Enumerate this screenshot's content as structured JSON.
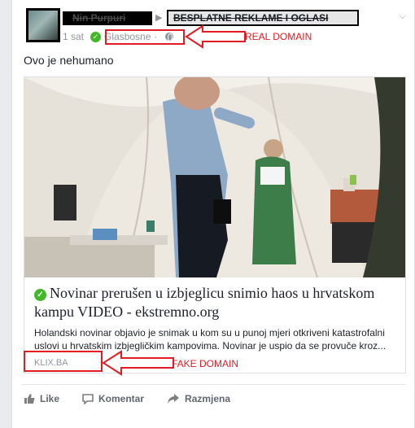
{
  "post": {
    "author": "Nin Purpuri",
    "group": "BESPLATNE REKLAME I OGLASI",
    "time": "1 sat",
    "privacy_label": "Glasbosne",
    "text": "Ovo je nehumano"
  },
  "link": {
    "headline": "Novinar prerušen u izbjeglicu snimio haos u hrvatskom kampu VIDEO - ekstremno.org",
    "description": "Holandski novinar objavio je snimak u kom su u punoj mjeri otkriveni katastrofalni uslovi u hrvatskim izbjegličkim kampovima. Novinar je uspio da se provuče kroz...",
    "domain": "KLIX.BA"
  },
  "annotations": {
    "real_domain": "REAL DOMAIN",
    "fake_domain": "FAKE DOMAIN",
    "color": "#e31b23"
  },
  "actions": {
    "like": "Like",
    "comment": "Komentar",
    "share": "Razmjena"
  },
  "icons": {
    "verified": "check-circle-icon",
    "privacy": "globe-icon",
    "menu": "chevron-down-icon"
  }
}
